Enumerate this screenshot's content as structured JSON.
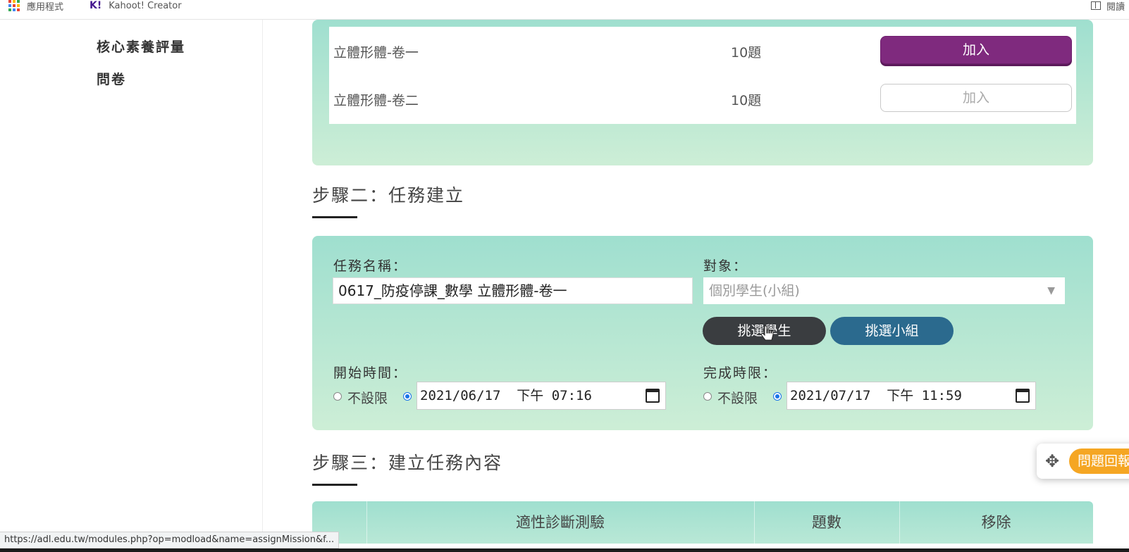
{
  "bookmarks": {
    "apps_label": "應用程式",
    "kahoot_logo": "K!",
    "kahoot_label": "Kahoot! Creator",
    "reader_label": "閱讀"
  },
  "sidebar": {
    "items": [
      {
        "label": "核心素養評量"
      },
      {
        "label": "問卷"
      }
    ]
  },
  "exam_list": {
    "rows": [
      {
        "name": "立體形體-卷一",
        "count": "10題",
        "action": "加入",
        "active": true
      },
      {
        "name": "立體形體-卷二",
        "count": "10題",
        "action": "加入",
        "active": false
      }
    ]
  },
  "step2": {
    "title": "步驟二：任務建立",
    "task_name_label": "任務名稱：",
    "task_name_value": "0617_防疫停課_數學 立體形體-卷一",
    "target_label": "對象：",
    "target_selected": "個別學生(小組)",
    "select_students": "挑選學生",
    "select_groups": "挑選小組",
    "start_label": "開始時間：",
    "start_unlimited": "不設限",
    "start_value": "2021/06/17  下午 07:16",
    "end_label": "完成時限：",
    "end_unlimited": "不設限",
    "end_value": "2021/07/17  下午 11:59"
  },
  "step3": {
    "title": "步驟三：建立任務內容",
    "col_test": "適性診斷測驗",
    "col_count": "題數",
    "col_remove": "移除"
  },
  "float_widget": {
    "label": "問題回報"
  },
  "status_url": "https://adl.edu.tw/modules.php?op=modload&name=assignMission&f...",
  "colors": {
    "purple_button": "#7f2a7e",
    "panel_top": "#9fdfcf",
    "panel_bottom": "#cdeed6",
    "dark_pill": "#3a3d40",
    "blue_pill": "#2b6a8e",
    "orange_pill": "#f5a623"
  }
}
